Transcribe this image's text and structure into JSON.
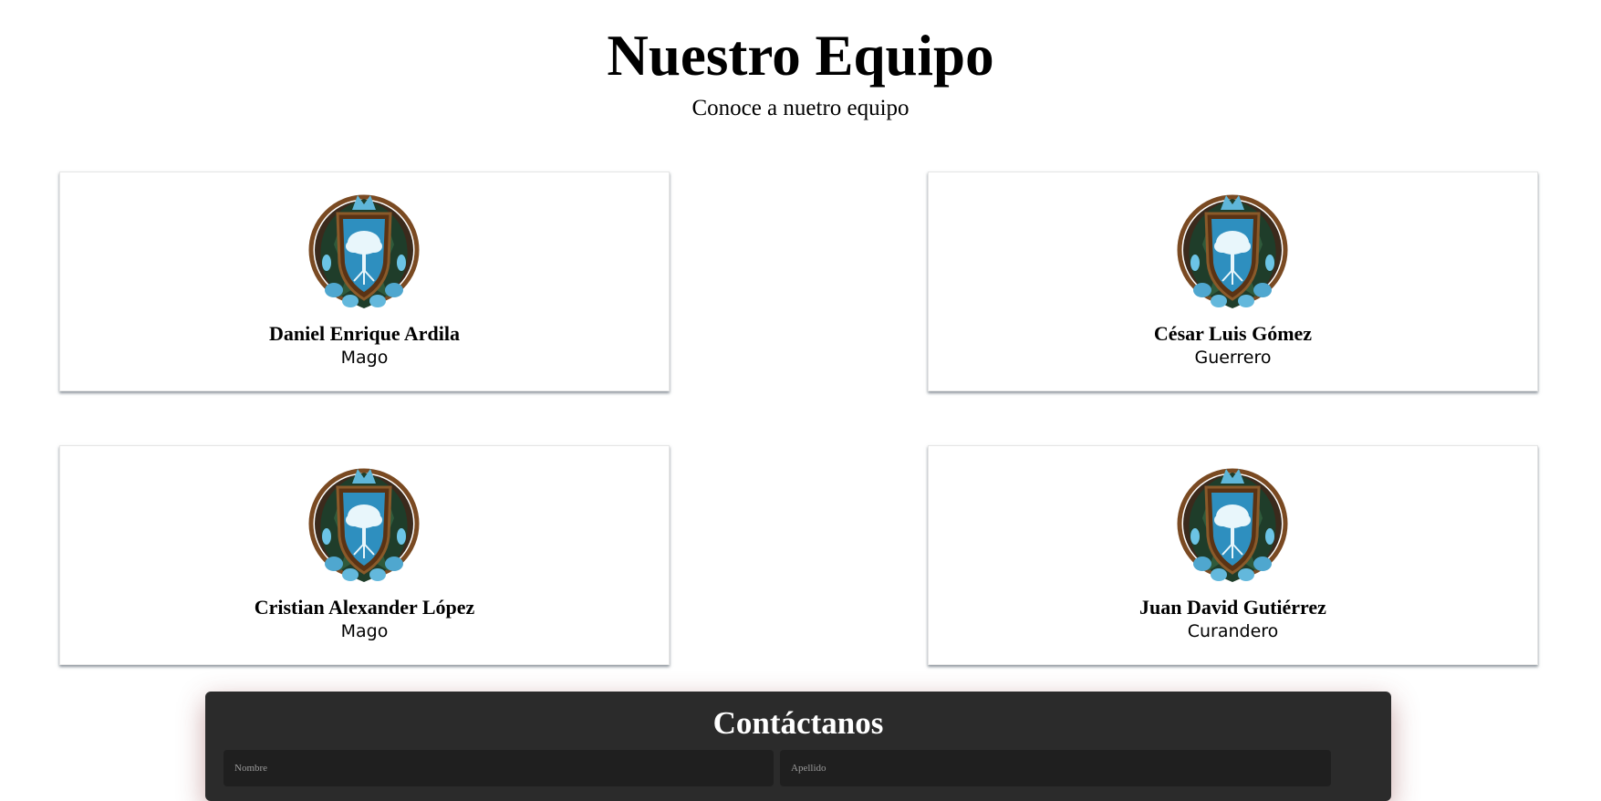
{
  "header": {
    "title": "Nuestro Equipo",
    "subtitle": "Conoce a nuetro equipo"
  },
  "team": [
    {
      "name": "Daniel Enrique Ardila",
      "role": "Mago",
      "emblem": "tree-crest-emblem"
    },
    {
      "name": "César Luis Gómez",
      "role": "Guerrero",
      "emblem": "tree-crest-emblem"
    },
    {
      "name": "Cristian Alexander López",
      "role": "Mago",
      "emblem": "tree-crest-emblem"
    },
    {
      "name": "Juan David Gutiérrez",
      "role": "Curandero",
      "emblem": "tree-crest-emblem"
    }
  ],
  "contact": {
    "title": "Contáctanos",
    "first_name_placeholder": "Nombre",
    "last_name_placeholder": "Apellido"
  },
  "colors": {
    "contact_bg": "#2b2b2b",
    "field_bg": "#1f1f1f",
    "emblem_ring": "#7a4a22",
    "emblem_blue": "#2e8fbf"
  }
}
